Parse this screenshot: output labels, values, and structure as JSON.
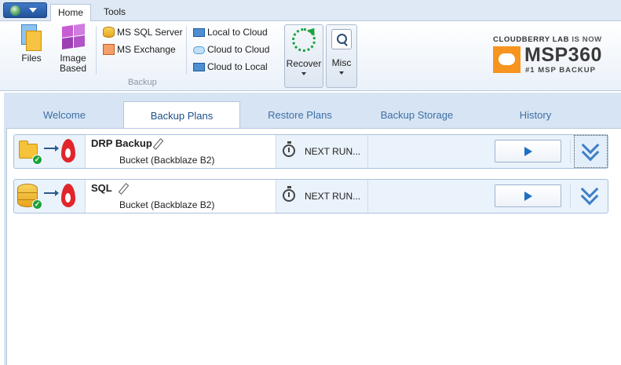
{
  "ribbon_tabs": {
    "home": "Home",
    "tools": "Tools"
  },
  "ribbon": {
    "files_label": "Files",
    "image_label": "Image\nBased",
    "ms_sql": "MS SQL Server",
    "ms_exchange": "MS Exchange",
    "backup_group": "Backup",
    "local_to_cloud": "Local to Cloud",
    "cloud_to_cloud": "Cloud to Cloud",
    "cloud_to_local": "Cloud to Local",
    "recover": "Recover",
    "misc": "Misc"
  },
  "brand": {
    "top_a": "CLOUDBERRY LAB",
    "top_b": " IS NOW",
    "name": "MSP360",
    "sub": "#1 MSP BACKUP",
    "accent": "#f7941d"
  },
  "main_tabs": [
    "Welcome",
    "Backup Plans",
    "Restore Plans",
    "Backup Storage",
    "History"
  ],
  "active_tab": "Backup Plans",
  "plans": [
    {
      "name": "DRP Backup",
      "destination": "Bucket (Backblaze B2)",
      "next_run": "NEXT RUN...",
      "source_icon": "folder-icon",
      "status": "check"
    },
    {
      "name": "SQL",
      "destination": "Bucket (Backblaze B2)",
      "next_run": "NEXT RUN...",
      "source_icon": "database-icon",
      "status": "check"
    }
  ],
  "colors": {
    "ribbon_bg": "#eaf1f9",
    "tab_text": "#3c6fa6",
    "panel_bg": "#d7e4f3",
    "play": "#1f6fc5"
  }
}
